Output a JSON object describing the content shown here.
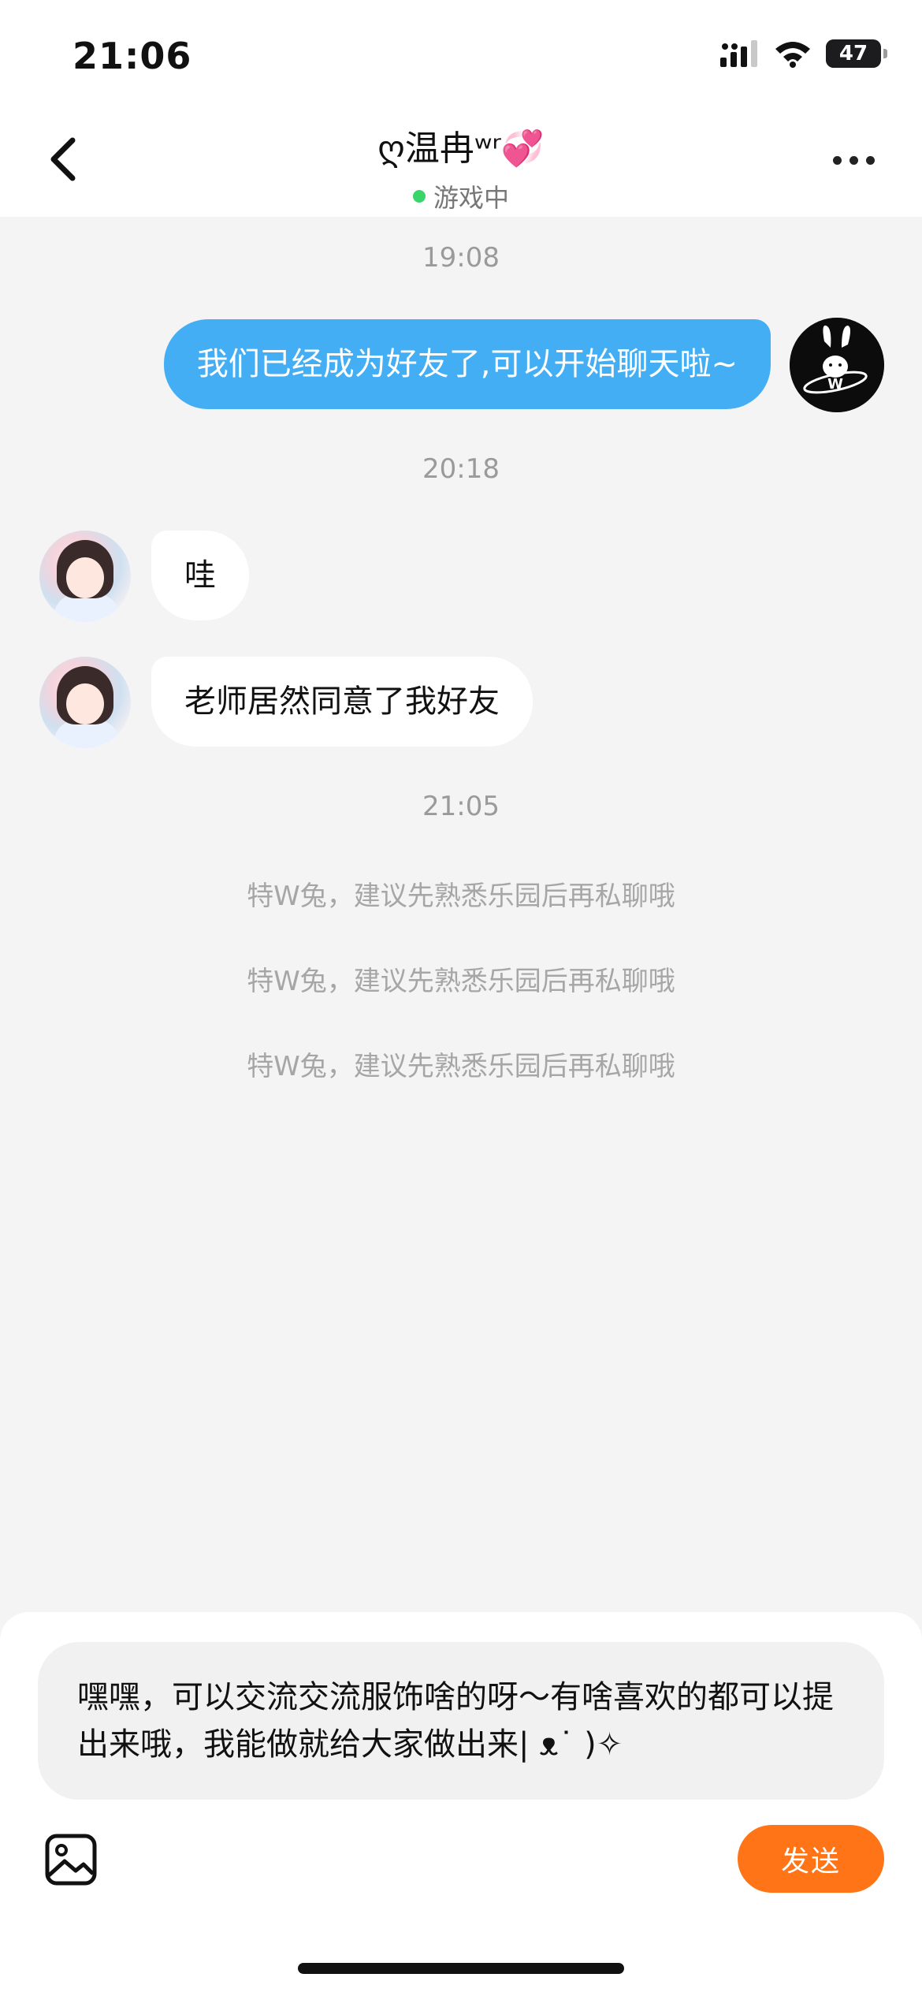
{
  "status_bar": {
    "time": "21:06",
    "battery_percent": "47",
    "battery_level": 0.47
  },
  "header": {
    "title": "ღ温冉ʷʳ",
    "title_emoji": "💞",
    "status": "游戏中",
    "online_color": "#39d46a"
  },
  "messages": [
    {
      "type": "time",
      "text": "19:08"
    },
    {
      "type": "outgoing",
      "text": "我们已经成为好友了,可以开始聊天啦~"
    },
    {
      "type": "time",
      "text": "20:18"
    },
    {
      "type": "incoming",
      "text": "哇"
    },
    {
      "type": "incoming",
      "text": "老师居然同意了我好友"
    },
    {
      "type": "time",
      "text": "21:05"
    },
    {
      "type": "system",
      "text": "特W兔，建议先熟悉乐园后再私聊哦"
    },
    {
      "type": "system",
      "text": "特W兔，建议先熟悉乐园后再私聊哦"
    },
    {
      "type": "system",
      "text": "特W兔，建议先熟悉乐园后再私聊哦"
    }
  ],
  "composer": {
    "draft_text": "嘿嘿，可以交流交流服饰啥的呀～有啥喜欢的都可以提出来哦，我能做就给大家做出来| ᴥ˙ )✧",
    "send_label": "发送"
  },
  "icons": {
    "back": "chevron-left-icon",
    "more": "more-horizontal-icon",
    "image": "image-icon",
    "signal": "signal-icon",
    "wifi": "wifi-icon",
    "battery": "battery-icon"
  },
  "colors": {
    "outgoing_bubble": "#44aef4",
    "send_button": "#ff7417",
    "background": "#f4f4f5"
  }
}
